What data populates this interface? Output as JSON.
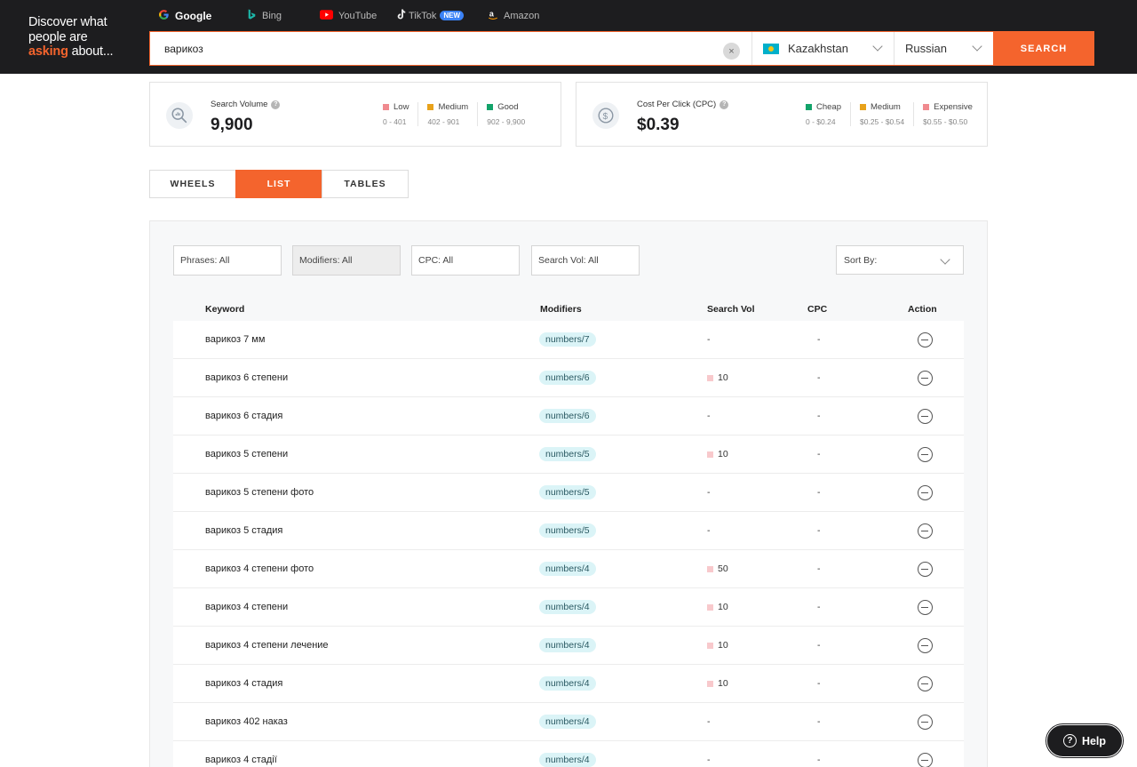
{
  "brand": {
    "line1": "Discover what",
    "line2": "people are",
    "accent": "asking",
    "line3_rest": " about..."
  },
  "engines": [
    {
      "label": "Google",
      "icon": "google-icon",
      "active": true
    },
    {
      "label": "Bing",
      "icon": "bing-icon",
      "active": false
    },
    {
      "label": "YouTube",
      "icon": "youtube-icon",
      "active": false
    },
    {
      "label": "TikTok",
      "icon": "tiktok-icon",
      "active": false,
      "badge": "NEW"
    },
    {
      "label": "Amazon",
      "icon": "amazon-icon",
      "active": false
    }
  ],
  "search": {
    "value": "варикоз",
    "clear": "×",
    "country": "Kazakhstan",
    "language": "Russian",
    "button": "SEARCH"
  },
  "volume_card": {
    "label": "Search Volume",
    "value": "9,900",
    "legend": [
      {
        "name": "Low",
        "range": "0 - 401",
        "color": "#f08a8f"
      },
      {
        "name": "Medium",
        "range": "402 - 901",
        "color": "#e8a21b"
      },
      {
        "name": "Good",
        "range": "902 - 9,900",
        "color": "#13a36a"
      }
    ]
  },
  "cpc_card": {
    "label": "Cost Per Click (CPC)",
    "value": "$0.39",
    "legend": [
      {
        "name": "Cheap",
        "range": "0 - $0.24",
        "color": "#13a36a"
      },
      {
        "name": "Medium",
        "range": "$0.25 - $0.54",
        "color": "#e8a21b"
      },
      {
        "name": "Expensive",
        "range": "$0.55 - $0.50",
        "color": "#f08a8f"
      }
    ]
  },
  "view_tabs": [
    {
      "label": "WHEELS",
      "active": false
    },
    {
      "label": "LIST",
      "active": true
    },
    {
      "label": "TABLES",
      "active": false
    }
  ],
  "filters": {
    "phrases": "Phrases: All",
    "modifiers": "Modifiers: All",
    "cpc": "CPC: All",
    "search_vol": "Search Vol: All",
    "sort": "Sort By:"
  },
  "table": {
    "headers": {
      "keyword": "Keyword",
      "modifiers": "Modifiers",
      "search_vol": "Search Vol",
      "cpc": "CPC",
      "action": "Action"
    },
    "rows": [
      {
        "keyword": "варикоз 7 мм",
        "modifier": "numbers/7",
        "vol": "-",
        "cpc": "-"
      },
      {
        "keyword": "варикоз 6 степени",
        "modifier": "numbers/6",
        "vol": "10",
        "cpc": "-"
      },
      {
        "keyword": "варикоз 6 стадия",
        "modifier": "numbers/6",
        "vol": "-",
        "cpc": "-"
      },
      {
        "keyword": "варикоз 5 степени",
        "modifier": "numbers/5",
        "vol": "10",
        "cpc": "-"
      },
      {
        "keyword": "варикоз 5 степени фото",
        "modifier": "numbers/5",
        "vol": "-",
        "cpc": "-"
      },
      {
        "keyword": "варикоз 5 стадия",
        "modifier": "numbers/5",
        "vol": "-",
        "cpc": "-"
      },
      {
        "keyword": "варикоз 4 степени фото",
        "modifier": "numbers/4",
        "vol": "50",
        "cpc": "-"
      },
      {
        "keyword": "варикоз 4 степени",
        "modifier": "numbers/4",
        "vol": "10",
        "cpc": "-"
      },
      {
        "keyword": "варикоз 4 степени лечение",
        "modifier": "numbers/4",
        "vol": "10",
        "cpc": "-"
      },
      {
        "keyword": "варикоз 4 стадия",
        "modifier": "numbers/4",
        "vol": "10",
        "cpc": "-"
      },
      {
        "keyword": "варикоз 402 наказ",
        "modifier": "numbers/4",
        "vol": "-",
        "cpc": "-"
      },
      {
        "keyword": "варикоз 4 стадії",
        "modifier": "numbers/4",
        "vol": "-",
        "cpc": "-"
      }
    ]
  },
  "help": {
    "label": "Help"
  }
}
